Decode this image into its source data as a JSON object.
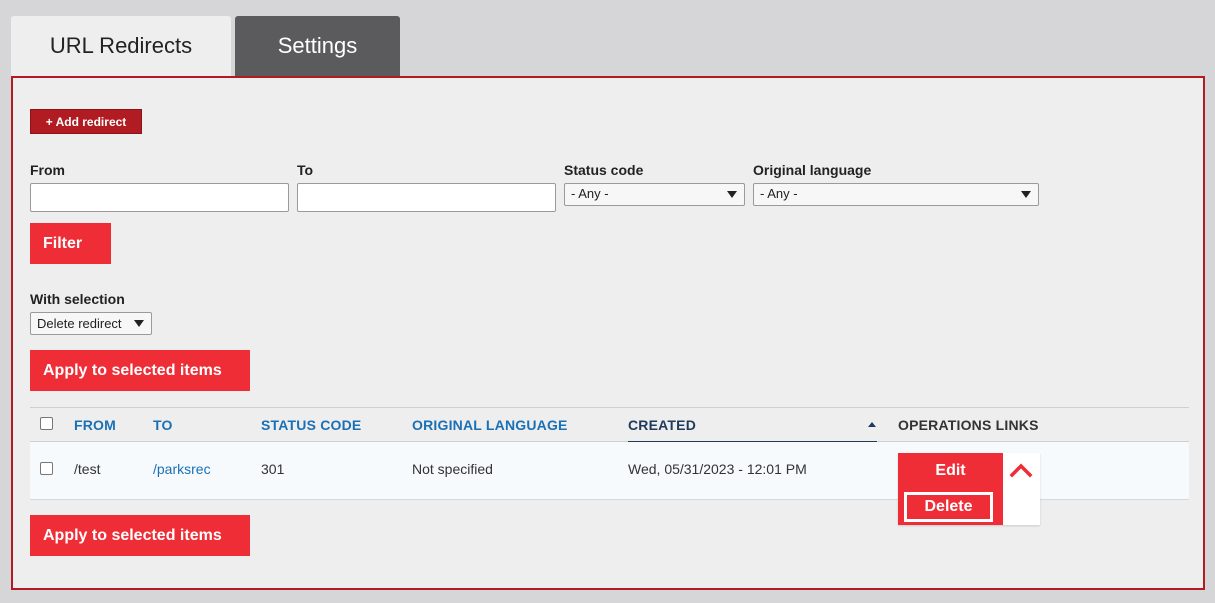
{
  "tabs": [
    {
      "label": "URL Redirects",
      "active": true
    },
    {
      "label": "Settings",
      "active": false
    }
  ],
  "add_redirect_label": "+ Add redirect",
  "filters": {
    "from_label": "From",
    "from_value": "",
    "to_label": "To",
    "to_value": "",
    "status_code_label": "Status code",
    "status_code_value": "- Any -",
    "language_label": "Original language",
    "language_value": "- Any -",
    "filter_button": "Filter"
  },
  "bulk": {
    "label": "With selection",
    "action_value": "Delete redirect",
    "apply_label": "Apply to selected items"
  },
  "table": {
    "headers": {
      "from": "FROM",
      "to": "TO",
      "status_code": "STATUS CODE",
      "original_language": "ORIGINAL LANGUAGE",
      "created": "CREATED",
      "operations": "OPERATIONS LINKS"
    },
    "rows": [
      {
        "from": "/test",
        "to": "/parksrec",
        "status_code": "301",
        "original_language": "Not specified",
        "created": "Wed, 05/31/2023 - 12:01 PM",
        "edit_label": "Edit",
        "delete_label": "Delete"
      }
    ]
  },
  "colors": {
    "accent_red": "#ee2d36",
    "dark_red": "#b01c22",
    "link_blue": "#1a70b5"
  }
}
